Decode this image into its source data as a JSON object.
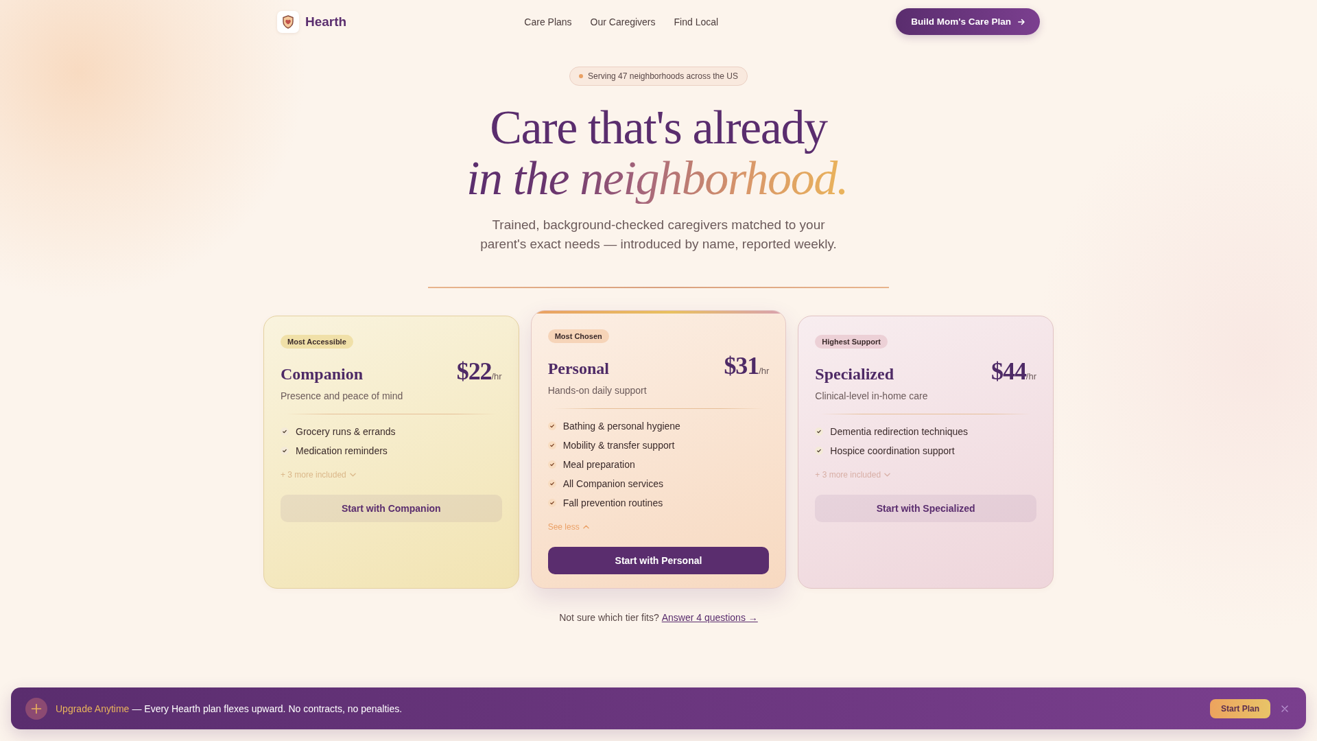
{
  "nav": {
    "brand": "Hearth",
    "links": [
      "Care Plans",
      "Our Caregivers",
      "Find Local"
    ],
    "cta": "Build Mom's Care Plan"
  },
  "hero": {
    "badge": "Serving 47 neighborhoods across the US",
    "headline": "Care that's already *in the neighborhood.*",
    "subtitle": "Trained, background-checked caregivers matched to your\nparent's exact needs — introduced by name, reported weekly."
  },
  "plans": [
    {
      "tag": "Most Accessible",
      "color": "#f0e0a8",
      "name": "Companion",
      "price": "$22",
      "unit": "/hr",
      "description": "Presence and peace of mind",
      "features": [
        "Grocery runs & errands",
        "Medication reminders"
      ],
      "toggle": "+ 3 more included",
      "expanded": false,
      "button": "Start with Companion",
      "featured": false
    },
    {
      "tag": "Most Chosen",
      "color": "#f6d4b8",
      "name": "Personal",
      "price": "$31",
      "unit": "/hr",
      "description": "Hands-on daily support",
      "features": [
        "Bathing & personal hygiene",
        "Mobility & transfer support",
        "Meal preparation",
        "All Companion services",
        "Fall prevention routines"
      ],
      "toggle": "See less",
      "expanded": true,
      "button": "Start with Personal",
      "featured": true
    },
    {
      "tag": "Highest Support",
      "color": "#ecd0d6",
      "name": "Specialized",
      "price": "$44",
      "unit": "/hr",
      "description": "Clinical-level in-home care",
      "features": [
        "Dementia redirection techniques",
        "Hospice coordination support"
      ],
      "toggle": "+ 3 more included",
      "expanded": false,
      "button": "Start with Specialized",
      "featured": false
    }
  ],
  "help": {
    "text": "Not sure which tier fits?",
    "link": "Answer 4 questions →"
  },
  "banner": {
    "title": "Upgrade Anytime",
    "message": "— Every Hearth plan flexes upward. No contracts, no penalties.",
    "button": "Start Plan"
  }
}
